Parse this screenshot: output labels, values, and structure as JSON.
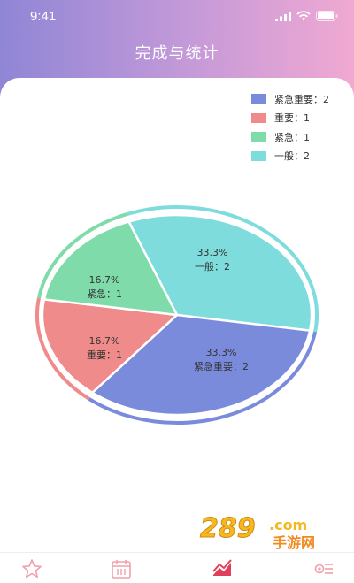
{
  "status_bar": {
    "time": "9:41"
  },
  "header": {
    "title": "完成与统计"
  },
  "chart_data": {
    "type": "pie",
    "legend_position": "top-right",
    "slices": [
      {
        "label": "紧急重要",
        "value": 2,
        "percent": "33.3%",
        "color": "#7b8bdc",
        "legend": "紧急重要：2",
        "percent_label": "33.3%",
        "name_label": "紧急重要：2"
      },
      {
        "label": "重要",
        "value": 1,
        "percent": "16.7%",
        "color": "#f08b8b",
        "legend": "重要：1",
        "percent_label": "16.7%",
        "name_label": "重要：1"
      },
      {
        "label": "紧急",
        "value": 1,
        "percent": "16.7%",
        "color": "#7fdcaa",
        "legend": "紧急：1",
        "percent_label": "16.7%",
        "name_label": "紧急：1"
      },
      {
        "label": "一般",
        "value": 2,
        "percent": "33.3%",
        "color": "#7fdcdc",
        "legend": "一般：2",
        "percent_label": "33.3%",
        "name_label": "一般：2"
      }
    ]
  },
  "pie_text": {
    "yiban": {
      "percent": "33.3%",
      "name": "一般：2"
    },
    "jinji": {
      "percent": "16.7%",
      "name": "紧急：1"
    },
    "zhongyao": {
      "percent": "16.7%",
      "name": "重要：1"
    },
    "jjzy": {
      "percent": "33.3%",
      "name": "紧急重要：2"
    }
  },
  "tabbar": {
    "items": [
      {
        "icon": "star-icon",
        "active": false
      },
      {
        "icon": "calendar-icon",
        "active": false
      },
      {
        "icon": "chart-icon",
        "active": true
      },
      {
        "icon": "settings-icon",
        "active": false
      }
    ]
  },
  "watermark": {
    "brand": "289",
    "suffix": ".com",
    "subtitle": "手游网"
  },
  "colors": {
    "accent": "#e0405a",
    "inactive_icon": "#f0a0aa"
  }
}
